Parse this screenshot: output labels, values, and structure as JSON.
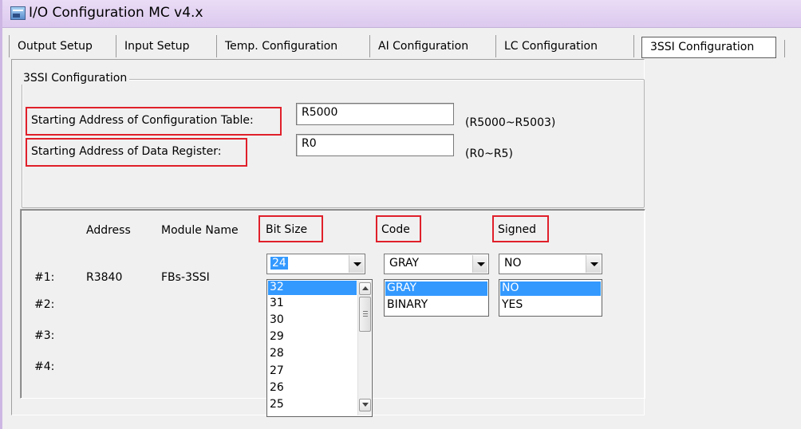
{
  "window": {
    "title": "I/O Configuration MC v4.x",
    "icon": "app-icon"
  },
  "tabs": [
    {
      "label": "Output Setup",
      "active": false
    },
    {
      "label": "Input Setup",
      "active": false
    },
    {
      "label": "Temp. Configuration",
      "active": false
    },
    {
      "label": "AI Configuration",
      "active": false
    },
    {
      "label": "LC Configuration",
      "active": false
    },
    {
      "label": "3SSI Configuration",
      "active": true
    }
  ],
  "group": {
    "title": "3SSI Configuration",
    "config_table": {
      "label": "Starting Address of Configuration Table:",
      "value": "R5000",
      "range": "(R5000~R5003)"
    },
    "data_register": {
      "label": "Starting Address of Data Register:",
      "value": "R0",
      "range": "(R0~R5)"
    }
  },
  "table": {
    "headers": {
      "address": "Address",
      "module": "Module Name",
      "bit_size": "Bit Size",
      "code": "Code",
      "signed": "Signed"
    },
    "rows": [
      {
        "id": "#1:",
        "address": "R3840",
        "module": "FBs-3SSI"
      },
      {
        "id": "#2:",
        "address": "",
        "module": ""
      },
      {
        "id": "#3:",
        "address": "",
        "module": ""
      },
      {
        "id": "#4:",
        "address": "",
        "module": ""
      }
    ]
  },
  "bit_size_combo": {
    "selected": "24",
    "options": [
      "32",
      "31",
      "30",
      "29",
      "28",
      "27",
      "26",
      "25"
    ],
    "highlighted": "32"
  },
  "code_combo": {
    "selected": "GRAY",
    "options": [
      "GRAY",
      "BINARY"
    ],
    "highlighted": "GRAY"
  },
  "signed_combo": {
    "selected": "NO",
    "options": [
      "NO",
      "YES"
    ],
    "highlighted": "NO"
  },
  "colors": {
    "highlight": "#e0202a",
    "selection": "#3399ff",
    "titlebar": "#dcc9ee"
  }
}
